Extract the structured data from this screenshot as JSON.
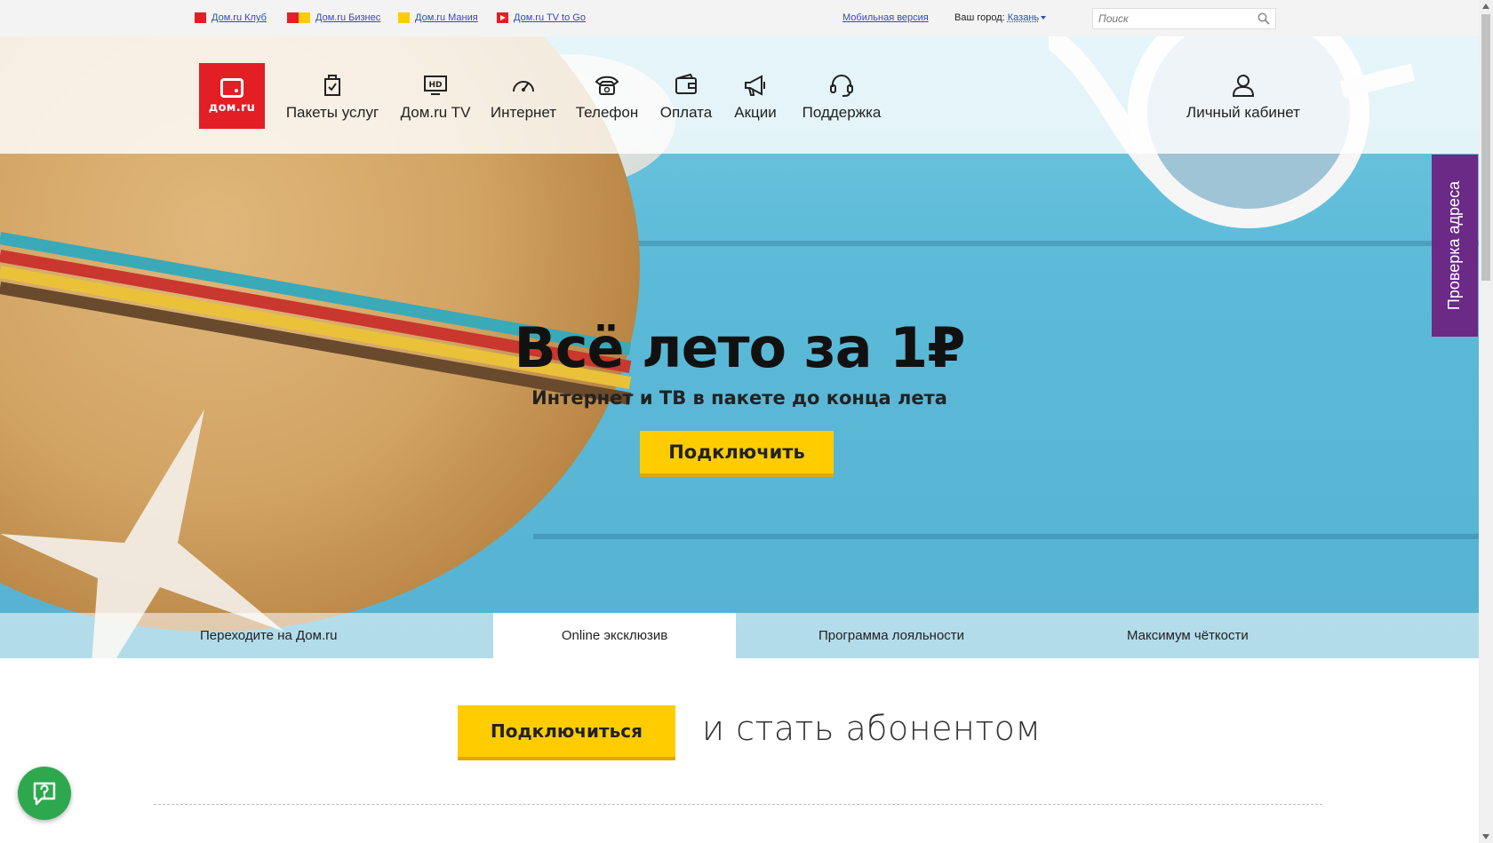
{
  "topbar": {
    "links": [
      {
        "label": "Дом.ru Клуб"
      },
      {
        "label": "Дом.ru Бизнес"
      },
      {
        "label": "Дом.ru Мания"
      },
      {
        "label": "Дом.ru TV to Go"
      }
    ],
    "mobile_version": "Мобильная версия",
    "city_label": "Ваш город:",
    "city_value": "Казань",
    "search_placeholder": "Поиск"
  },
  "logo": {
    "text": "дом.ru",
    "color": "#e31e24"
  },
  "nav": {
    "items": [
      {
        "label": "Пакеты услуг",
        "icon": "package-icon"
      },
      {
        "label": "Дом.ru TV",
        "icon": "hd-tv-icon"
      },
      {
        "label": "Интернет",
        "icon": "speedometer-icon"
      },
      {
        "label": "Телефон",
        "icon": "phone-icon"
      },
      {
        "label": "Оплата",
        "icon": "wallet-icon"
      },
      {
        "label": "Акции",
        "icon": "megaphone-icon"
      },
      {
        "label": "Поддержка",
        "icon": "headset-icon"
      }
    ],
    "account": {
      "label": "Личный кабинет",
      "icon": "user-icon"
    }
  },
  "side_tab": {
    "label": "Проверка адреса",
    "color": "#6b2a86"
  },
  "promo": {
    "title": "Всё лето за 1₽",
    "subtitle": "Интернет и ТВ в пакете до конца лета",
    "button": "Подключить"
  },
  "tabs": [
    {
      "label": "Переходите на Дом.ru",
      "active": false
    },
    {
      "label": "Online эксклюзив",
      "active": true
    },
    {
      "label": "Программа лояльности",
      "active": false
    },
    {
      "label": "Максимум чёткости",
      "active": false
    }
  ],
  "cta": {
    "button": "Подключиться",
    "text": "и стать абонентом"
  },
  "colors": {
    "accent_yellow": "#ffcc00",
    "brand_red": "#e31e24",
    "help_green": "#2ea84f"
  }
}
